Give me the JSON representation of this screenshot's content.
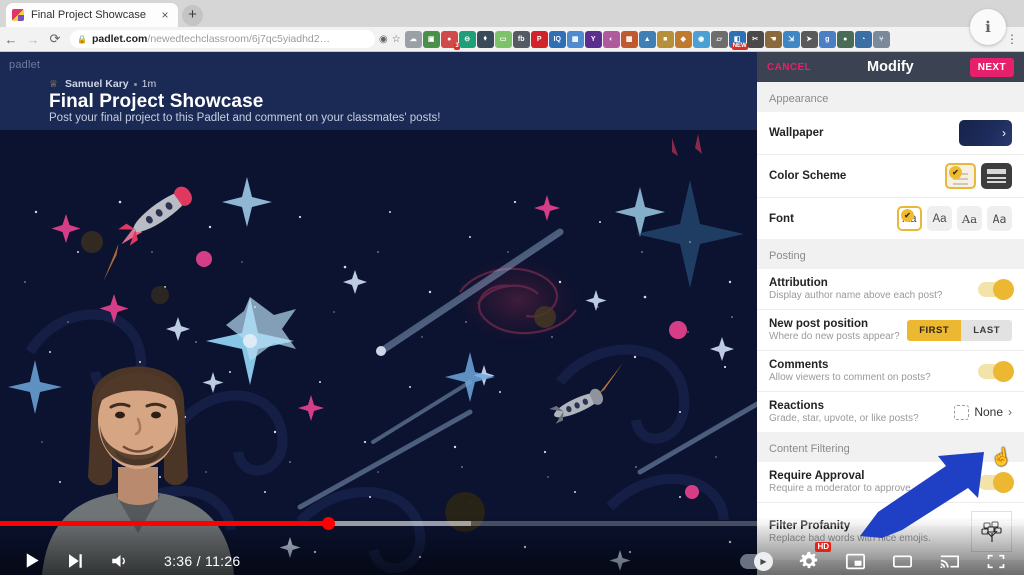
{
  "browser": {
    "tab": {
      "title": "Final Project Showcase",
      "close_label": "×",
      "favicon": "padlet-favicon"
    },
    "newtab_label": "+",
    "nav": {
      "back": "←",
      "forward": "→",
      "reload": "⟳"
    },
    "omnibox": {
      "lock_icon": "lock-icon",
      "url_domain": "padlet.com",
      "url_path": "/newedtechclassroom/6j7qc5yiadhd2…",
      "share_icon": "share-icon",
      "bookmark_icon": "star-icon"
    },
    "extensions": [
      {
        "name": "cloud-extension-icon",
        "color": "#9aa0a6",
        "glyph": "☁"
      },
      {
        "name": "screenshot-extension-icon",
        "color": "#4a8f4a",
        "glyph": "▣"
      },
      {
        "name": "tasks-extension-icon",
        "color": "#d04a4a",
        "glyph": "●",
        "badge": "3"
      },
      {
        "name": "tab-extension-icon",
        "color": "#1f9e7a",
        "glyph": "⊖"
      },
      {
        "name": "shield-extension-icon",
        "color": "#3b4a57",
        "glyph": "⬧"
      },
      {
        "name": "doc-extension-icon",
        "color": "#7ec36a",
        "glyph": "▭"
      },
      {
        "name": "fb-extension-icon",
        "color": "#555b63",
        "glyph": "fb"
      },
      {
        "name": "pinterest-extension-icon",
        "color": "#d0232b",
        "glyph": "P"
      },
      {
        "name": "iq-extension-icon",
        "color": "#2f6fb5",
        "glyph": "IQ"
      },
      {
        "name": "store-extension-icon",
        "color": "#4f8bd0",
        "glyph": "▦"
      },
      {
        "name": "yahoo-extension-icon",
        "color": "#5b2d8e",
        "glyph": "Y"
      },
      {
        "name": "palette-extension-icon",
        "color": "#b05a9e",
        "glyph": "◐"
      },
      {
        "name": "grid-extension-icon",
        "color": "#c05a2e",
        "glyph": "▦"
      },
      {
        "name": "image-extension-icon",
        "color": "#3f7fb5",
        "glyph": "▲"
      },
      {
        "name": "photo-extension-icon",
        "color": "#b58f3a",
        "glyph": "■"
      },
      {
        "name": "compass-extension-icon",
        "color": "#c07a2e",
        "glyph": "◆"
      },
      {
        "name": "target-extension-icon",
        "color": "#4a9fd4",
        "glyph": "◉"
      },
      {
        "name": "eraser-extension-icon",
        "color": "#6d6d6d",
        "glyph": "▱"
      },
      {
        "name": "new-extension-icon",
        "color": "#2f6fb5",
        "glyph": "◧",
        "badge": "NEW"
      },
      {
        "name": "scissors-extension-icon",
        "color": "#4a4a4a",
        "glyph": "✂"
      },
      {
        "name": "hand-extension-icon",
        "color": "#8a6a3a",
        "glyph": "☚"
      },
      {
        "name": "resize-extension-icon",
        "color": "#3f86c4",
        "glyph": "⇲"
      },
      {
        "name": "cursor-extension-icon",
        "color": "#5a5a5a",
        "glyph": "➤"
      },
      {
        "name": "grammar-extension-icon",
        "color": "#4a7fc4",
        "glyph": "g"
      },
      {
        "name": "circle-extension-icon",
        "color": "#4a6b55",
        "glyph": "●"
      },
      {
        "name": "loop-extension-icon",
        "color": "#3a6ea5",
        "glyph": "◔"
      },
      {
        "name": "pin-extension-icon",
        "color": "#7a8a9a",
        "glyph": "⑂"
      }
    ],
    "kebab_label": "⋮",
    "profile_label": "ℹ"
  },
  "padlet": {
    "logo": "padlet",
    "author": "Samuel Kary",
    "time_ago": "1m",
    "title": "Final Project Showcase",
    "subtitle": "Post your final project to this Padlet and comment on your classmates' posts!",
    "wallpaper_theme": "outer-space"
  },
  "panel": {
    "cancel_label": "CANCEL",
    "title": "Modify",
    "next_label": "NEXT",
    "sections": [
      {
        "label": "Appearance",
        "rows": [
          {
            "title": "Wallpaper",
            "subtitle": "",
            "control": "thumbnail-chevron",
            "chevron": "›"
          },
          {
            "title": "Color Scheme",
            "subtitle": "",
            "control": "scheme-picker",
            "options": [
              "light",
              "dark"
            ],
            "selected": "light",
            "check_glyph": "✔"
          },
          {
            "title": "Font",
            "subtitle": "",
            "control": "font-picker",
            "options": [
              "Aa",
              "Aa",
              "Aa",
              "Aa"
            ],
            "selected_index": 0,
            "check_glyph": "✔"
          }
        ]
      },
      {
        "label": "Posting",
        "rows": [
          {
            "title": "Attribution",
            "subtitle": "Display author name above each post?",
            "control": "toggle",
            "value": "on"
          },
          {
            "title": "New post position",
            "subtitle": "Where do new posts appear?",
            "control": "segmented",
            "options": [
              "FIRST",
              "LAST"
            ],
            "selected": "FIRST"
          },
          {
            "title": "Comments",
            "subtitle": "Allow viewers to comment on posts?",
            "control": "toggle",
            "value": "on"
          },
          {
            "title": "Reactions",
            "subtitle": "Grade, star, upvote, or like posts?",
            "control": "value-chevron",
            "value": "None",
            "chevron": "›"
          }
        ]
      },
      {
        "label": "Content Filtering",
        "rows": [
          {
            "title": "Require Approval",
            "subtitle": "Require a moderator to approve.",
            "control": "toggle",
            "value": "on"
          },
          {
            "title": "Filter Profanity",
            "subtitle": "Replace bad words with nice emojis.",
            "control": "icon-box",
            "icon": "broccoli-tree-icon",
            "glyph": "🥦"
          }
        ]
      }
    ]
  },
  "player": {
    "play_label": "▶",
    "next_label": "⏭",
    "volume_label": "🔊",
    "current_time": "3:36",
    "total_time": "11:26",
    "time_display": "3:36 / 11:26",
    "progress_percent": 32,
    "buffered_percent": 46,
    "autoplay": "on",
    "quality_badge": "HD",
    "settings_label": "⚙",
    "miniplayer_label": "miniplayer-icon",
    "theater_label": "theater-icon",
    "cast_label": "cast-icon",
    "fullscreen_label": "fullscreen-icon"
  },
  "annotation": {
    "arrow_color": "#1f3fc4",
    "points_to": "Require Approval toggle",
    "cursor": "hand-pointer"
  },
  "colors": {
    "padlet_header": "#1b2a55",
    "panel_header": "#3b4252",
    "accent_pink": "#e6206a",
    "accent_yellow": "#ecb731",
    "progress_red": "#ff0000"
  }
}
